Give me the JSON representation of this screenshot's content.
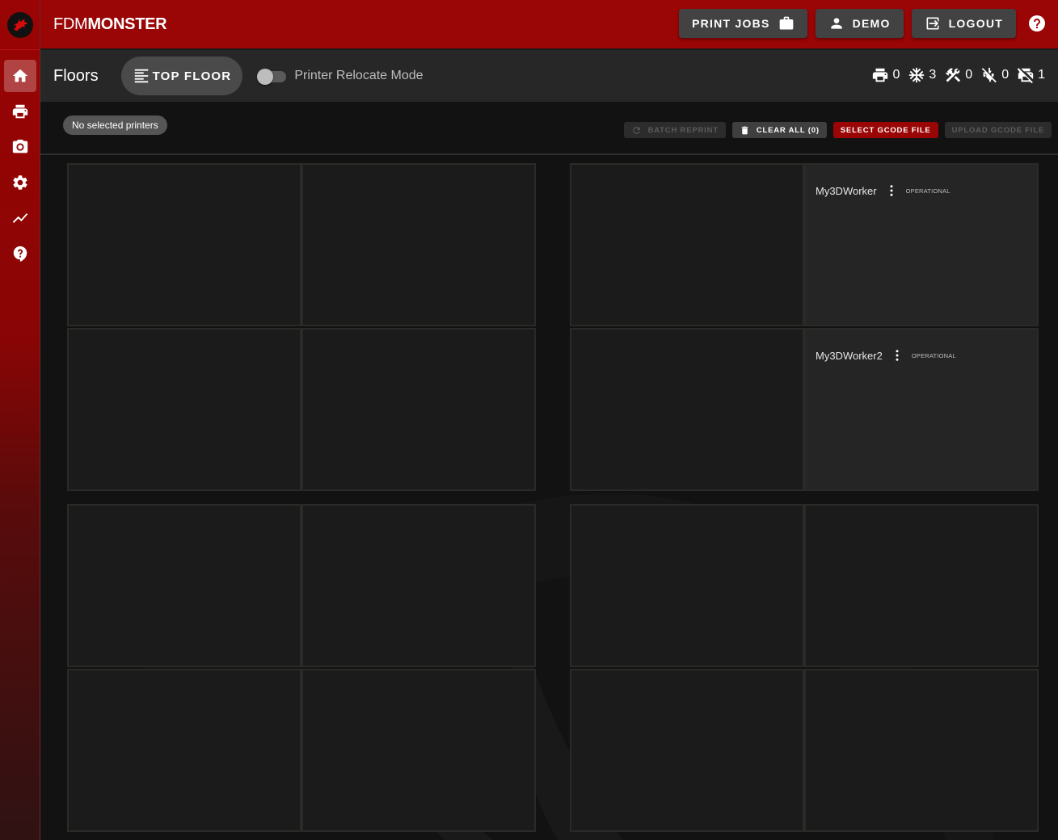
{
  "app": {
    "brand_light": "FDM",
    "brand_bold": "MONSTER",
    "accent_color": "#9a0505"
  },
  "sidebar": {
    "items": [
      {
        "name": "home",
        "icon": "home-icon",
        "active": true
      },
      {
        "name": "printers",
        "icon": "printer-icon",
        "active": false
      },
      {
        "name": "cameras",
        "icon": "camera-icon",
        "active": false
      },
      {
        "name": "settings",
        "icon": "gear-icon",
        "active": false
      },
      {
        "name": "statistics",
        "icon": "chart-line-icon",
        "active": false
      },
      {
        "name": "help",
        "icon": "help-icon",
        "active": false
      }
    ]
  },
  "appbar": {
    "print_jobs_label": "PRINT JOBS",
    "user_label": "DEMO",
    "logout_label": "LOGOUT"
  },
  "floorbar": {
    "title": "Floors",
    "floor_tab_label": "TOP FLOOR",
    "relocate_label": "Printer Relocate Mode",
    "relocate_enabled": false,
    "stats": [
      {
        "icon": "printer-icon",
        "label": "printing",
        "value": "0"
      },
      {
        "icon": "snowflake-icon",
        "label": "idle",
        "value": "3"
      },
      {
        "icon": "tools-icon",
        "label": "maintenance",
        "value": "0"
      },
      {
        "icon": "disconnected-icon",
        "label": "disconnected",
        "value": "0"
      },
      {
        "icon": "printer-off-icon",
        "label": "disabled",
        "value": "1"
      }
    ]
  },
  "selection": {
    "chip_label": "No selected printers",
    "batch_reprint_label": "BATCH REPRINT",
    "clear_all_label": "CLEAR ALL (0)",
    "select_gcode_label": "SELECT GCODE FILE",
    "upload_gcode_label": "UPLOAD GCODE FILE"
  },
  "printers": [
    {
      "name": "My3DWorker",
      "state": "OPERATIONAL"
    },
    {
      "name": "My3DWorker2",
      "state": "OPERATIONAL"
    }
  ]
}
